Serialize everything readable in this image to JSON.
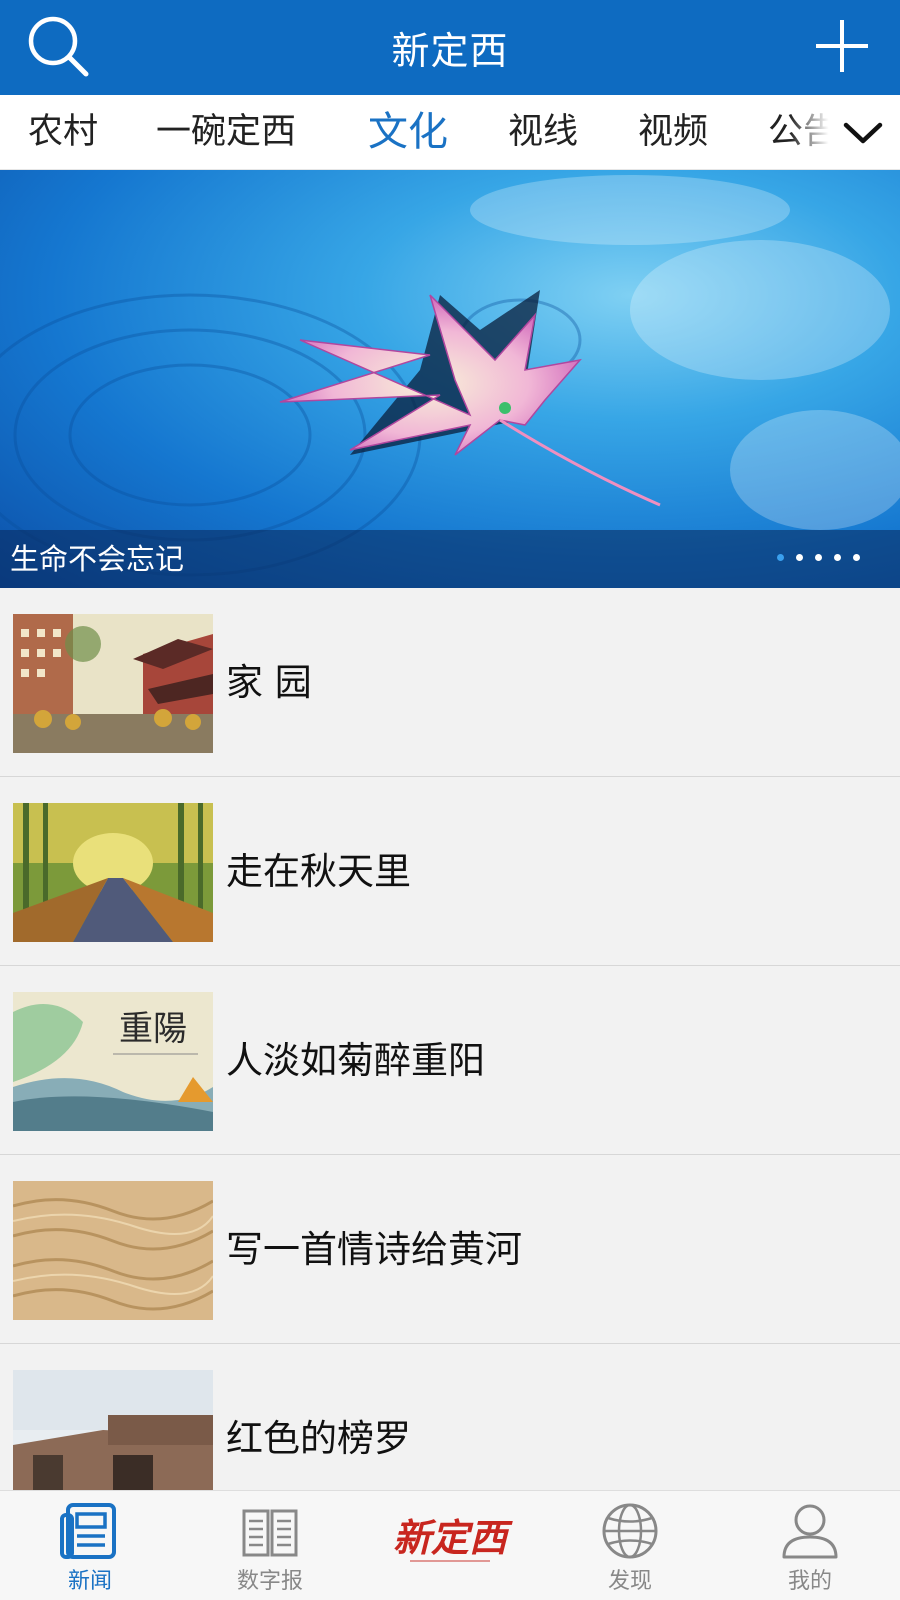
{
  "header": {
    "title": "新定西",
    "search_icon": "search-icon",
    "add_icon": "plus-icon",
    "background": "#0e6bc1"
  },
  "tabs": {
    "items": [
      {
        "label": "农村"
      },
      {
        "label": "一碗定西"
      },
      {
        "label": "文化",
        "active": true
      },
      {
        "label": "视线"
      },
      {
        "label": "视频"
      },
      {
        "label": "公告"
      }
    ],
    "active_color": "#1a72c4",
    "more_icon": "chevron-down-icon"
  },
  "banner": {
    "caption": "生命不会忘记",
    "slide_count": 5,
    "active_slide": 1
  },
  "news": [
    {
      "title": "家 园"
    },
    {
      "title": "走在秋天里"
    },
    {
      "title": "人淡如菊醉重阳",
      "thumb_text": "重陽"
    },
    {
      "title": "写一首情诗给黄河"
    },
    {
      "title": "红色的榜罗"
    }
  ],
  "bottom_nav": {
    "items": [
      {
        "label": "新闻",
        "icon": "newspaper-icon",
        "active": true
      },
      {
        "label": "数字报",
        "icon": "open-book-icon"
      },
      {
        "label": "新定西",
        "icon": "brand-logo"
      },
      {
        "label": "发现",
        "icon": "globe-icon"
      },
      {
        "label": "我的",
        "icon": "user-icon"
      }
    ],
    "active_color": "#1a72c4"
  }
}
